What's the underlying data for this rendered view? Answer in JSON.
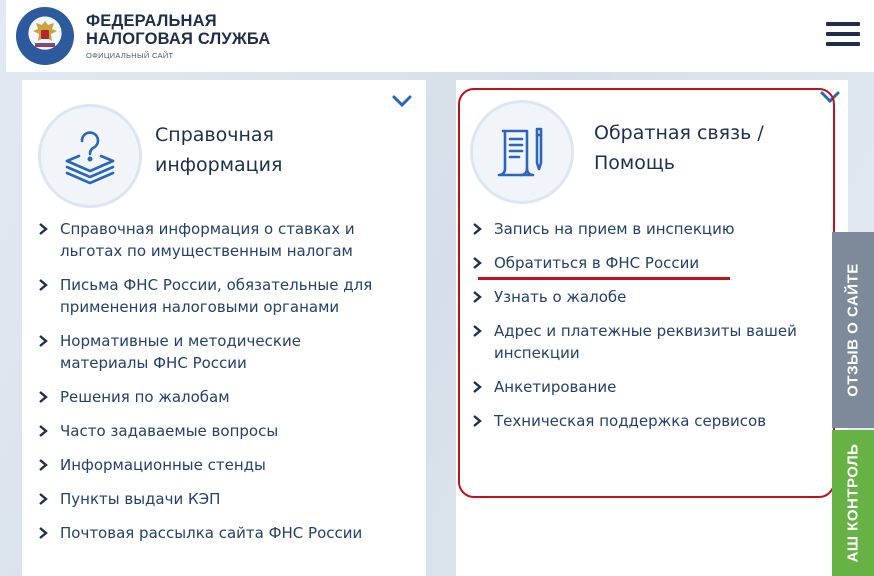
{
  "header": {
    "brand_line1": "ФЕДЕРАЛЬНАЯ",
    "brand_line2": "НАЛОГОВАЯ СЛУЖБА",
    "brand_line3": "ОФИЦИАЛЬНЫЙ САЙТ",
    "logo_icon": "fns-emblem-icon",
    "menu_icon": "hamburger-menu-icon"
  },
  "left_card": {
    "title_line1": "Справочная",
    "title_line2": "информация",
    "icon": "question-stack-icon",
    "links": [
      {
        "line1": "Справочная информация о ставках и",
        "line2": "льготах по имущественным налогам"
      },
      {
        "line1": "Письма ФНС России, обязательные для",
        "line2": "применения налоговыми органами"
      },
      {
        "line1": "Нормативные и методические",
        "line2": "материалы ФНС России"
      },
      {
        "line1": "Решения по жалобам",
        "line2": ""
      },
      {
        "line1": "Часто задаваемые вопросы",
        "line2": ""
      },
      {
        "line1": "Информационные стенды",
        "line2": ""
      },
      {
        "line1": "Пункты выдачи КЭП",
        "line2": ""
      },
      {
        "line1": "Почтовая рассылка сайта ФНС России",
        "line2": ""
      }
    ]
  },
  "right_card": {
    "title_line1": "Обратная связь /",
    "title_line2": "Помощь",
    "icon": "document-pen-icon",
    "links": [
      {
        "line1": "Запись на прием в инспекцию",
        "line2": ""
      },
      {
        "line1": "Обратиться в ФНС России",
        "line2": ""
      },
      {
        "line1": "Узнать о жалобе",
        "line2": ""
      },
      {
        "line1": "Адрес и платежные реквизиты вашей",
        "line2": "инспекции"
      },
      {
        "line1": "Анкетирование",
        "line2": ""
      },
      {
        "line1": "Техническая поддержка сервисов",
        "line2": ""
      }
    ]
  },
  "side_tabs": {
    "feedback": "ОТЗЫВ О САЙТЕ",
    "control": "АШ КОНТРОЛЬ"
  },
  "colors": {
    "accent_red": "#c0121e",
    "link_blue": "#24406b",
    "tab_gray": "#7d8a99",
    "tab_green": "#67b244"
  }
}
